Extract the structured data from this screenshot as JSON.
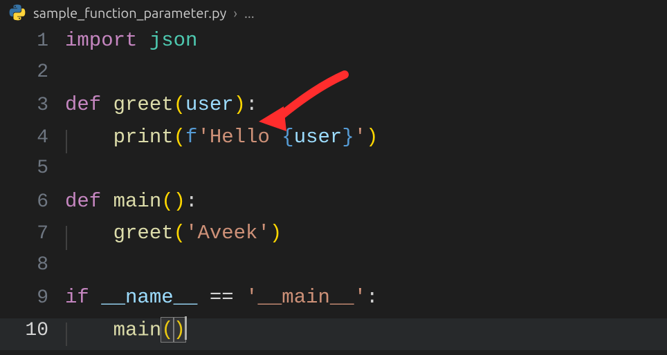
{
  "breadcrumb": {
    "file": "sample_function_parameter.py",
    "chevron": "›",
    "ellipsis": "..."
  },
  "gutter": {
    "1": "1",
    "2": "2",
    "3": "3",
    "4": "4",
    "5": "5",
    "6": "6",
    "7": "7",
    "8": "8",
    "9": "9",
    "10": "10"
  },
  "code": {
    "l1_import": "import",
    "l1_json": "json",
    "l3_def": "def",
    "l3_fn": "greet",
    "l3_lp": "(",
    "l3_param": "user",
    "l3_rp": ")",
    "l3_colon": ":",
    "l4_print": "print",
    "l4_lp": "(",
    "l4_f": "f",
    "l4_s1": "'Hello ",
    "l4_lb": "{",
    "l4_user": "user",
    "l4_rb": "}",
    "l4_s2": "'",
    "l4_rp": ")",
    "l6_def": "def",
    "l6_fn": "main",
    "l6_lp": "(",
    "l6_rp": ")",
    "l6_colon": ":",
    "l7_fn": "greet",
    "l7_lp": "(",
    "l7_str": "'Aveek'",
    "l7_rp": ")",
    "l9_if": "if",
    "l9_name": "__name__",
    "l9_eq": "==",
    "l9_str": "'__main__'",
    "l9_colon": ":",
    "l10_fn": "main",
    "l10_lp": "(",
    "l10_rp": ")"
  }
}
